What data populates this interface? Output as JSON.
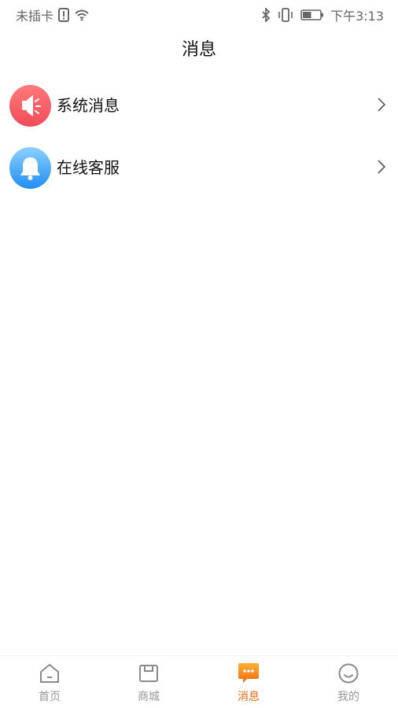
{
  "status_bar": {
    "carrier": "未插卡",
    "time": "下午3:13",
    "battery_level": 0.5,
    "icons": [
      "sim-alert-icon",
      "wifi-icon",
      "bluetooth-icon",
      "vibrate-icon",
      "battery-icon"
    ]
  },
  "header": {
    "title": "消息"
  },
  "list": {
    "items": [
      {
        "label": "系统消息",
        "icon": "speaker-icon",
        "color": "#f14a5a"
      },
      {
        "label": "在线客服",
        "icon": "bell-icon",
        "color": "#1f8ef3"
      }
    ]
  },
  "tabbar": {
    "tabs": [
      {
        "label": "首页",
        "icon": "home-icon"
      },
      {
        "label": "商城",
        "icon": "store-icon"
      },
      {
        "label": "消息",
        "icon": "message-icon",
        "active": true,
        "color": "#f06a10"
      },
      {
        "label": "我的",
        "icon": "profile-icon"
      }
    ]
  }
}
